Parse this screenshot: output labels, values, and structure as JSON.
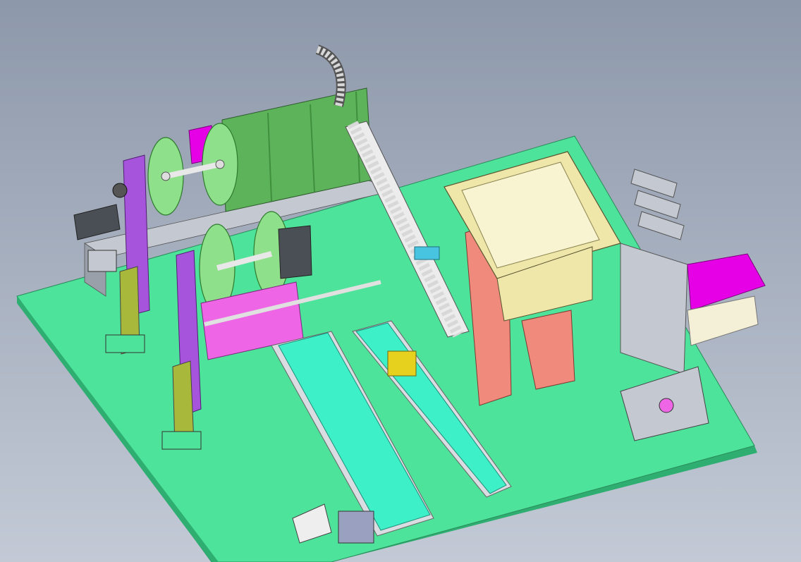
{
  "viewport": {
    "background_top": "#8d98aa",
    "background_bottom": "#c3cad6"
  },
  "scene": {
    "name": "assembly-machine-cad-model",
    "colors": {
      "base_plate": "#4ee39a",
      "base_plate_side": "#2fae72",
      "conveyor_belt": "#3ef0c8",
      "conveyor_frame": "#d9dde2",
      "winding_reels": "#8fe08a",
      "side_frame_purple": "#a654dc",
      "carriage_magenta": "#ee66e6",
      "back_panel_green": "#5db35a",
      "hopper_cream": "#efe6aa",
      "support_salmon": "#f08a7c",
      "guide_plates_gray": "#c4c8d0",
      "bracket_olive": "#a7b83a",
      "magenta_slide": "#e600e6",
      "motor_dark": "#4a4f55",
      "motor_light": "#eeeeee",
      "cable_chain": "#d8d8d8",
      "cyan_part": "#49c4e0",
      "yellow_part": "#e6d21e"
    }
  }
}
